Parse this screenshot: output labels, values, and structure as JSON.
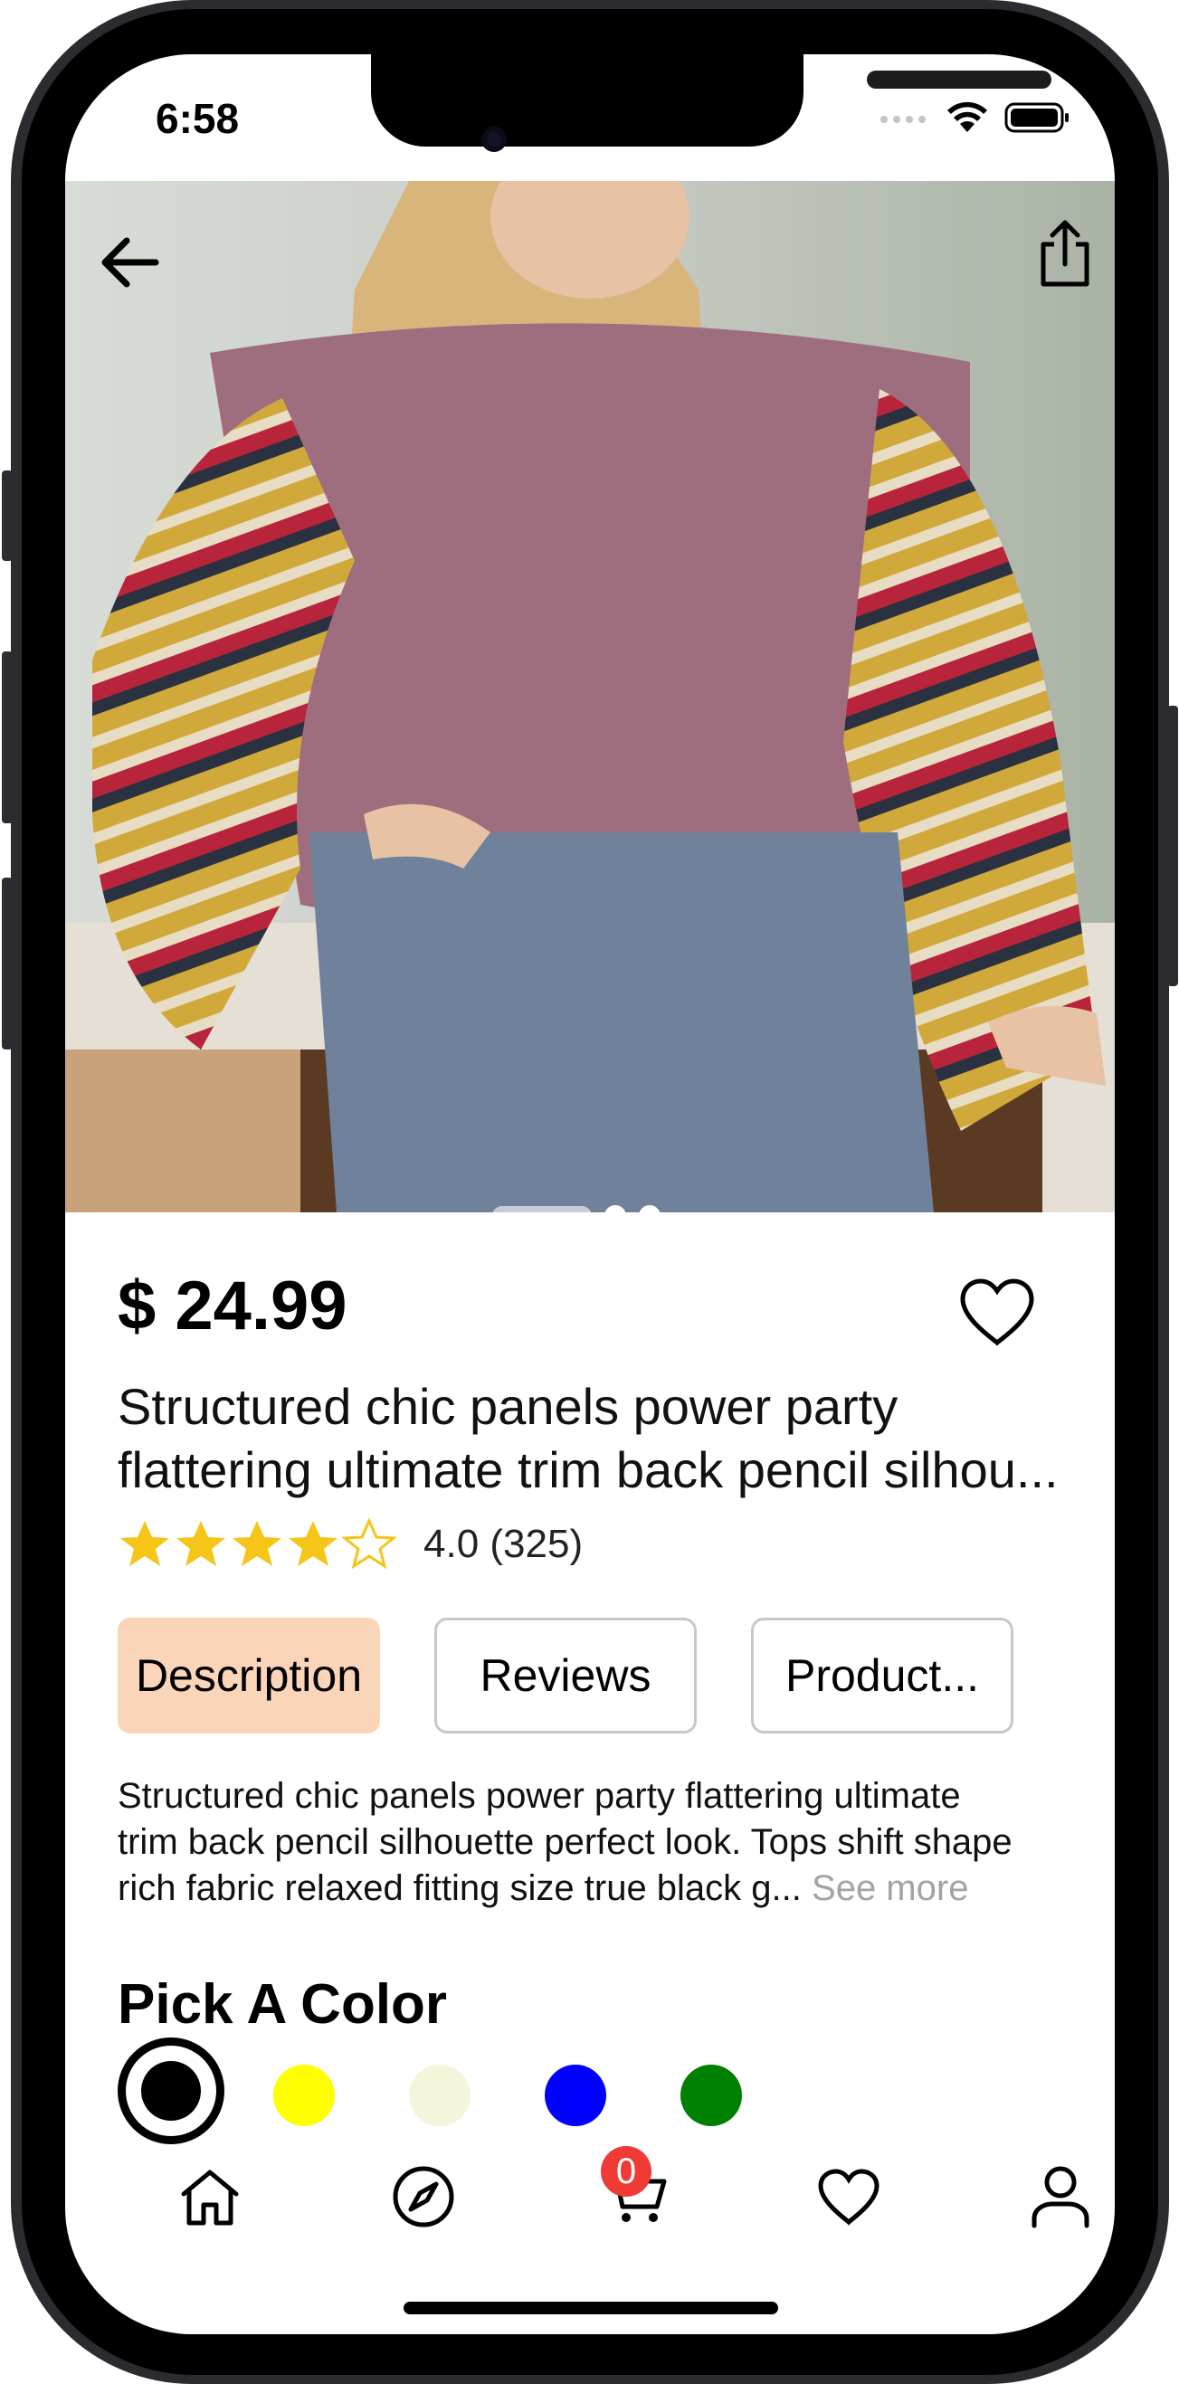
{
  "status_bar": {
    "time": "6:58"
  },
  "product": {
    "price": "$ 24.99",
    "title_line1": "Structured chic panels power party",
    "title_line2": "flattering ultimate trim back pencil silhou...",
    "rating": 4.0,
    "rating_text": "4.0 (325)",
    "image_pages": 3,
    "current_image": 1
  },
  "tabs": [
    {
      "label": "Description",
      "active": true
    },
    {
      "label": "Reviews",
      "active": false
    },
    {
      "label": "Product...",
      "active": false
    }
  ],
  "description": {
    "line1": "Structured chic panels power party flattering ultimate",
    "line2": "trim back pencil silhouette perfect look. Tops shift shape",
    "line3": "rich fabric relaxed fitting size true black g...",
    "see_more": "See more"
  },
  "color_picker": {
    "title": "Pick A Color",
    "colors": [
      "#000000",
      "#ffff00",
      "#f5f5dc",
      "#0000ff",
      "#008000"
    ],
    "selected_index": 0
  },
  "bottom_nav": {
    "items": [
      "home-icon",
      "compass-icon",
      "cart-icon",
      "heart-icon",
      "profile-icon"
    ],
    "cart_count": "0"
  },
  "accent_colors": {
    "tab_active_bg": "#fbd5b9",
    "badge": "#ef3a36",
    "star": "#f5c518"
  }
}
